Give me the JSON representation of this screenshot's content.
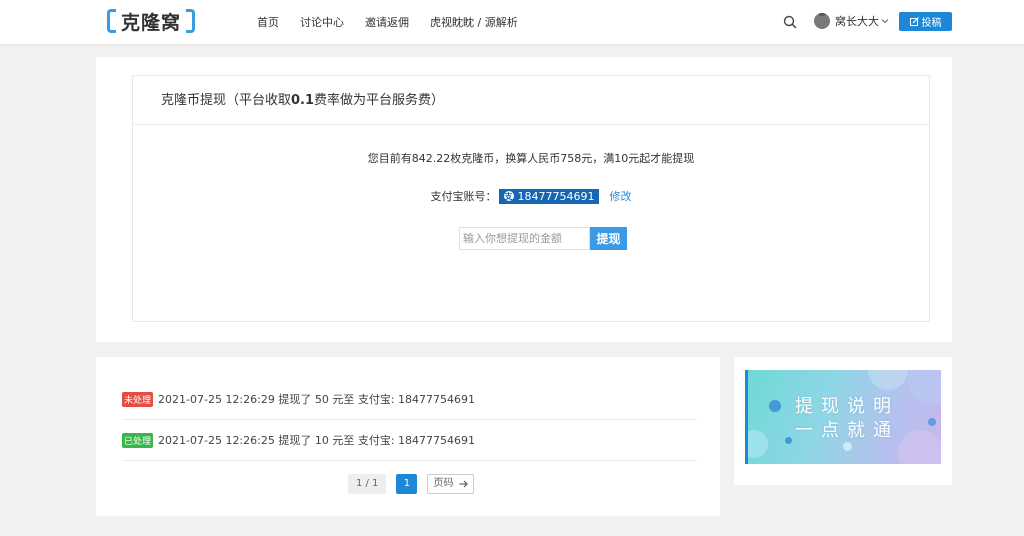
{
  "header": {
    "logo_text": "克隆窝",
    "nav": [
      "首页",
      "讨论中心",
      "邀请返佣",
      "虎视眈眈 / 源解析"
    ],
    "user_name": "窝长大大",
    "post_button": "投稿"
  },
  "withdraw": {
    "title_prefix": "克隆币提现（平台收取",
    "title_rate": "0.1",
    "title_suffix": "费率做为平台服务费）",
    "balance_text": "您目前有842.22枚克隆币，换算人民币758元，满10元起才能提现",
    "alipay_label": "支付宝账号：",
    "alipay_account": "18477754691",
    "edit_label": "修改",
    "amount_placeholder": "输入你想提现的金额",
    "submit_label": "提现"
  },
  "records": {
    "items": [
      {
        "status": "未处理",
        "text": "2021-07-25 12:26:29 提现了 50 元至 支付宝: 18477754691"
      },
      {
        "status": "已处理",
        "text": "2021-07-25 12:26:25 提现了 10 元至 支付宝: 18477754691"
      }
    ],
    "pager": {
      "info": "1 / 1",
      "current": "1",
      "jump_label": "页码"
    }
  },
  "sidebar": {
    "banner_line1": "提现说明",
    "banner_line2": "一点就通"
  },
  "colors": {
    "accent": "#1e88d8",
    "pending": "#e54d42",
    "done": "#39b54a"
  }
}
